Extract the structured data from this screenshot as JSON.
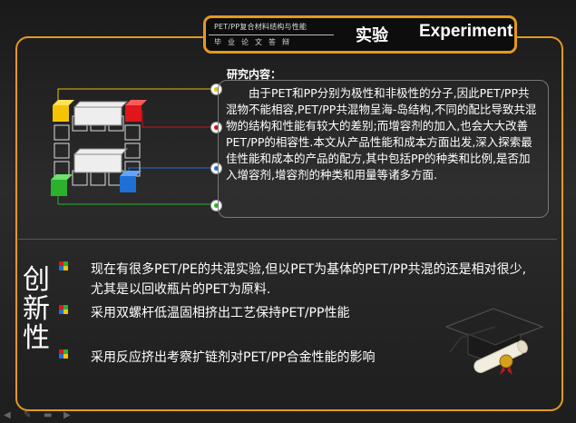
{
  "header": {
    "course": "PET/PP复合材料结构与性能",
    "subtitle": "毕业论文答辩",
    "title_cn": "实验",
    "title_en": "Experiment"
  },
  "research": {
    "heading": "研究内容：",
    "body": "由于PET和PP分别为极性和非极性的分子,因此PET/PP共混物不能相容,PET/PP共混物呈海-岛结构,不同的配比导致共混物的结构和性能有较大的差别;而增容剂的加入,也会大大改善PET/PP的相容性.本文从产品性能和成本方面出发,深入探索最佳性能和成本的产品的配方,其中包括PP的种类和比例,是否加入增容剂,增容剂的种类和用量等诸多方面."
  },
  "innovation": {
    "chars": [
      "创",
      "新",
      "性"
    ],
    "bullets": [
      "现在有很多PET/PE的共混实验,但以PET为基体的PET/PP共混的还是相对很少,尤其是以回收瓶片的PET为原料.",
      "采用双螺杆低温固相挤出工艺保持PET/PP性能",
      "采用反应挤出考察扩链剂对PET/PP合金性能的影响"
    ]
  },
  "colors": {
    "accent": "#e39a1c",
    "cube_yellow": "#f5c400",
    "cube_red": "#e0161b",
    "cube_green": "#2bb12e",
    "cube_blue": "#1f6fd6"
  },
  "icons": [
    "cube-diagram-icon",
    "graduation-cap-icon",
    "diploma-icon",
    "bullet-icon"
  ]
}
